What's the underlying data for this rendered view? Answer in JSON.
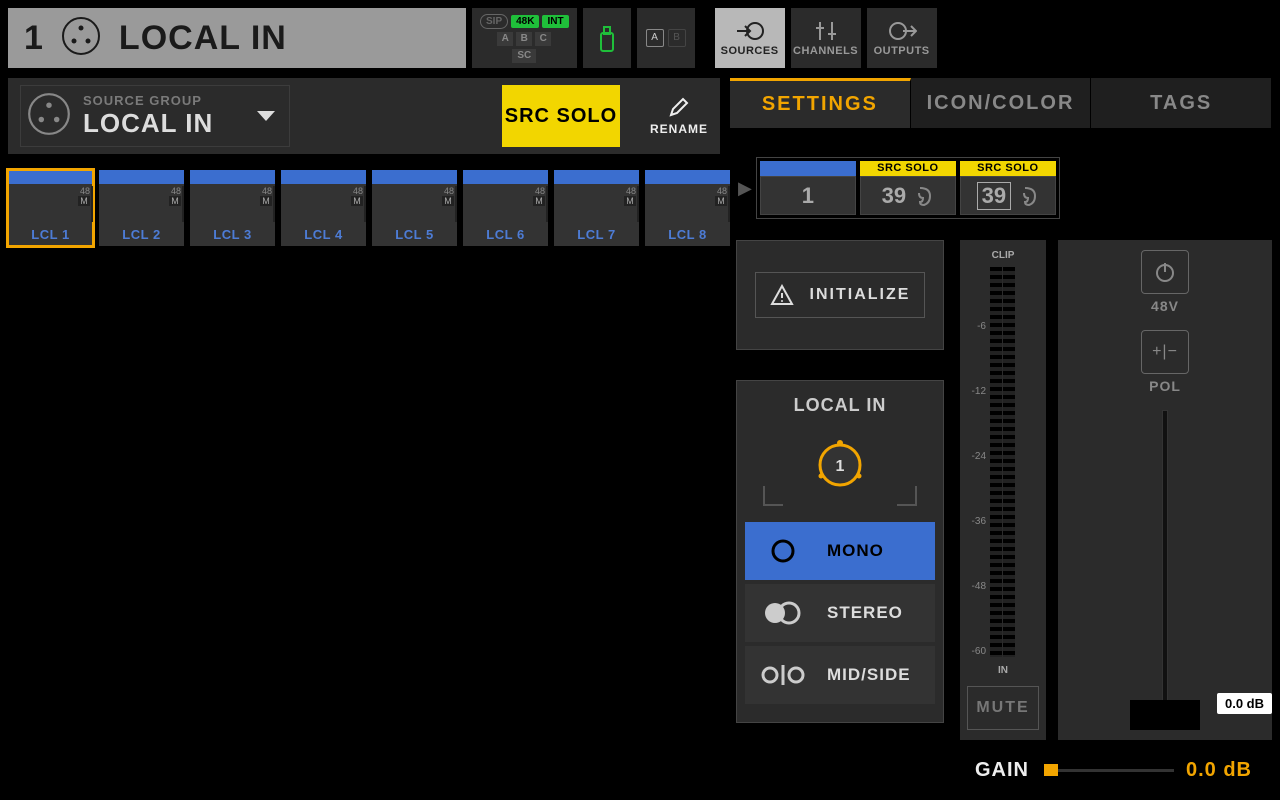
{
  "header": {
    "channel_num": "1",
    "title": "LOCAL IN"
  },
  "status": {
    "sip": "SIP",
    "rate": "48K",
    "clk": "INT",
    "a": "A",
    "b": "B",
    "c": "C",
    "sc": "SC"
  },
  "scene": {
    "a": "A",
    "b": "B"
  },
  "nav": {
    "sources": "SOURCES",
    "channels": "CHANNELS",
    "outputs": "OUTPUTS"
  },
  "srcgroup": {
    "label": "SOURCE GROUP",
    "value": "LOCAL IN",
    "solo": "SRC SOLO",
    "rename": "RENAME"
  },
  "tiles": [
    {
      "name": "LCL 1",
      "p": "48",
      "m": "M",
      "selected": true
    },
    {
      "name": "LCL 2",
      "p": "48",
      "m": "M"
    },
    {
      "name": "LCL 3",
      "p": "48",
      "m": "M"
    },
    {
      "name": "LCL 4",
      "p": "48",
      "m": "M"
    },
    {
      "name": "LCL 5",
      "p": "48",
      "m": "M"
    },
    {
      "name": "LCL 6",
      "p": "48",
      "m": "M"
    },
    {
      "name": "LCL 7",
      "p": "48",
      "m": "M"
    },
    {
      "name": "LCL 8",
      "p": "48",
      "m": "M"
    }
  ],
  "tabs": {
    "settings": "SETTINGS",
    "icon": "ICON/COLOR",
    "tags": "TAGS"
  },
  "selstrip": {
    "c1": {
      "top": "",
      "num": "1"
    },
    "c2": {
      "top": "SRC SOLO",
      "num": "39"
    },
    "c3": {
      "top": "SRC SOLO",
      "num": "39"
    }
  },
  "init": "INITIALIZE",
  "local_in": {
    "title": "LOCAL IN",
    "knob": "1"
  },
  "modes": {
    "mono": "MONO",
    "stereo": "STEREO",
    "midside": "MID/SIDE"
  },
  "meter": {
    "clip": "CLIP",
    "in": "IN",
    "scale": [
      "",
      "-6",
      "-12",
      "-24",
      "-36",
      "-48",
      "-60"
    ]
  },
  "mute": "MUTE",
  "right": {
    "v48": "48V",
    "pol": "POL",
    "pill": "0.0 dB"
  },
  "gain": {
    "label": "GAIN",
    "value": "0.0 dB"
  }
}
